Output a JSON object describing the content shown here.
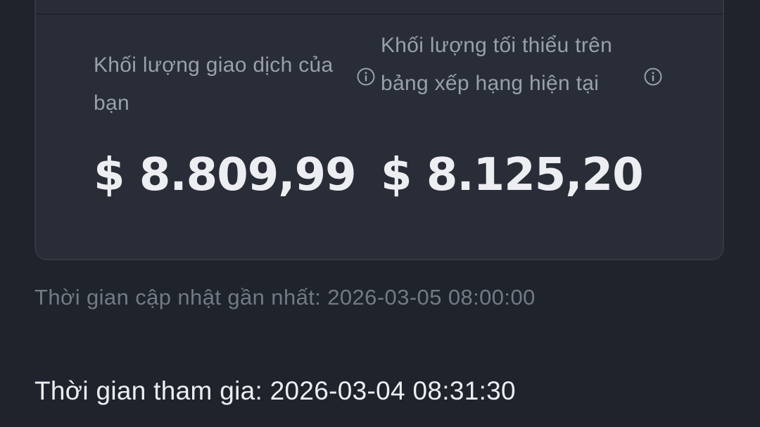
{
  "card": {
    "your_volume": {
      "label": "Khối lượng giao dịch của bạn",
      "value": "$ 8.809,99",
      "icon": "info-icon"
    },
    "min_volume": {
      "label": "Khối lượng tối thiểu trên bảng xếp hạng hiện tại",
      "value": "$ 8.125,20",
      "icon": "info-icon"
    }
  },
  "updated_text": "Thời gian cập nhật gần nhất: 2026-03-05 08:00:00",
  "joined_text": "Thời gian tham gia: 2026-03-04 08:31:30",
  "colors": {
    "background": "#1f232b",
    "card": "#282d37",
    "primary_text": "#eceef2",
    "secondary_text": "#9aa0ab",
    "muted_text": "#737a86"
  }
}
